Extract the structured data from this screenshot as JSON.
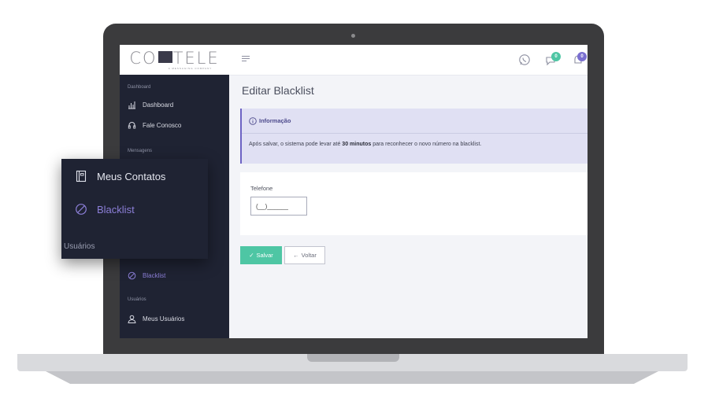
{
  "logo": {
    "text_left": "CO",
    "text_right": "TELE",
    "tagline": "A MESSAGING COMPANY"
  },
  "topbar": {
    "chat_badge": "0",
    "notif_badge": "0",
    "badge_color_chat": "#4ec6a4",
    "badge_color_notif": "#7a6fd0"
  },
  "sidebar": {
    "sections": [
      {
        "label": "Dashboard"
      },
      {
        "label": "Mensagens"
      },
      {
        "label": "Usuários"
      }
    ],
    "items": [
      {
        "label": "Dashboard",
        "icon": "bar-chart-icon"
      },
      {
        "label": "Fale Conosco",
        "icon": "headset-icon"
      },
      {
        "label": "Blacklist",
        "icon": "ban-icon",
        "active": true
      },
      {
        "label": "Meus Usuários",
        "icon": "user-icon"
      }
    ]
  },
  "zoom": {
    "items": [
      {
        "label": "Meus Contatos",
        "icon": "contacts-book-icon"
      },
      {
        "label": "Blacklist",
        "icon": "ban-icon",
        "active": true
      }
    ],
    "section": "Usuários"
  },
  "page": {
    "title": "Editar Blacklist",
    "info": {
      "heading": "Informação",
      "body_before": "Após salvar, o sistema pode levar até ",
      "body_bold": "30 minutos",
      "body_after": " para reconhecer o novo número na blacklist."
    },
    "form": {
      "phone_label": "Telefone",
      "phone_value": "(__)______"
    },
    "buttons": {
      "save": "Salvar",
      "back": "Voltar"
    }
  },
  "colors": {
    "accent": "#6d63c4",
    "success": "#4ec6a4",
    "sidebar_bg": "#1f2333"
  }
}
